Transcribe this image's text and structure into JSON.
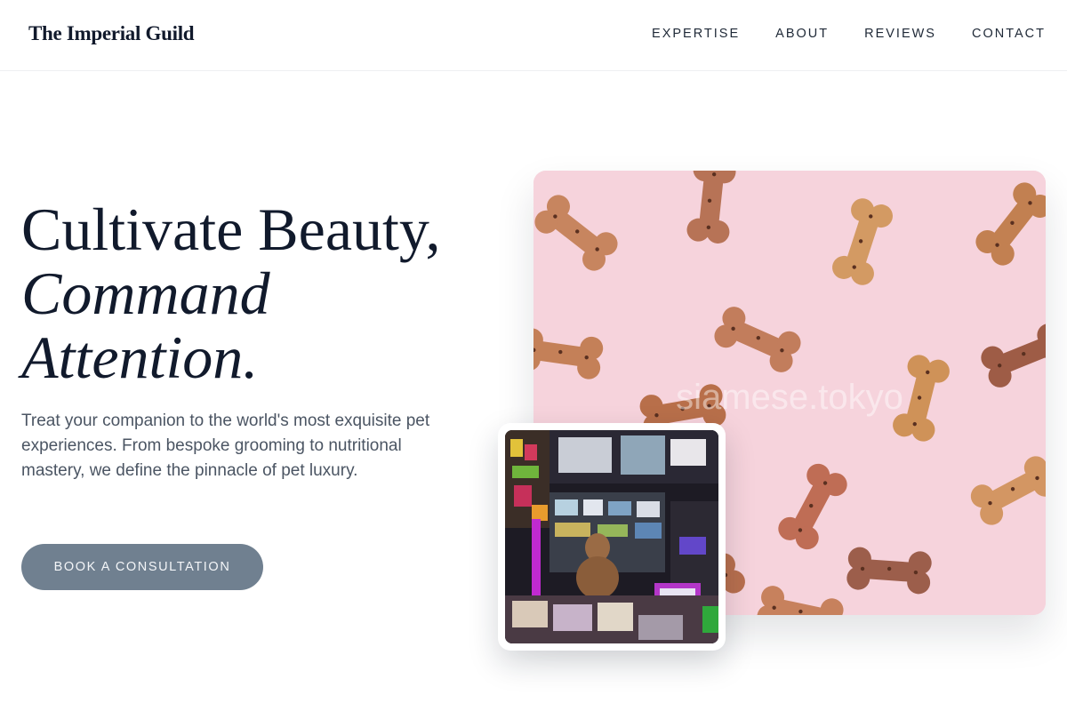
{
  "header": {
    "brand": "The Imperial Guild",
    "nav": [
      {
        "label": "EXPERTISE"
      },
      {
        "label": "ABOUT"
      },
      {
        "label": "REVIEWS"
      },
      {
        "label": "CONTACT"
      }
    ]
  },
  "hero": {
    "headline_line1": "Cultivate Beauty,",
    "headline_line2": "Command",
    "headline_line3": "Attention.",
    "description": "Treat your companion to the world's most exquisite pet experiences. From bespoke grooming to nutritional mastery, we define the pinnacle of pet luxury.",
    "cta_label": "BOOK A CONSULTATION"
  },
  "images": {
    "main_photo": {
      "subject": "dog-bone-biscuits-on-pink-background",
      "watermark": "siamese.tokyo"
    },
    "inset_photo": {
      "subject": "dog-in-convenience-store"
    }
  },
  "colors": {
    "ink": "#111a2c",
    "body_text": "#4b5563",
    "button": "#708090",
    "photo_pink": "#f6d3dc"
  }
}
